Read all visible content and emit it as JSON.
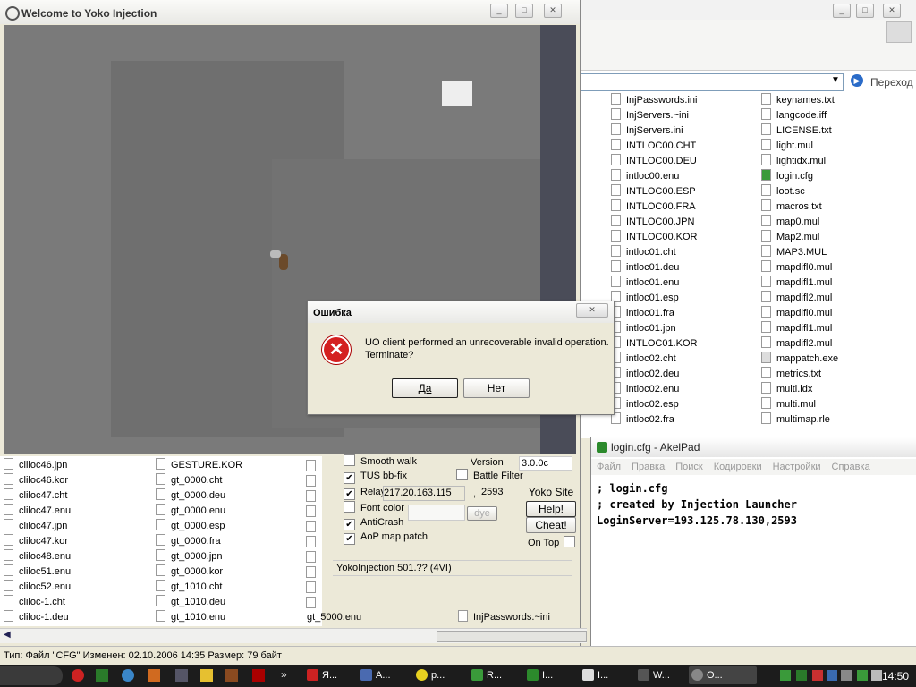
{
  "yoko_window": {
    "title": "Welcome to Yoko Injection",
    "settings": {
      "smooth_walk": "Smooth walk",
      "tus_bbfix": "TUS bb-fix",
      "relay_label": "Relay",
      "relay_ip": "217.20.163.115",
      "relay_sep": ",",
      "relay_port": "2593",
      "font_color": "Font color",
      "dye": "dye",
      "anticrash": "AntiCrash",
      "aop_patch": "AoP map patch",
      "version_label": "Version",
      "version_value": "3.0.0c",
      "battle_filter": "Battle Filter",
      "yoko_site": "Yoko Site",
      "help": "Help!",
      "cheat": "Cheat!",
      "on_top": "On Top",
      "status": "YokoInjection 501.?? (4VI)"
    }
  },
  "error_dialog": {
    "title": "Ошибка",
    "message_line1": "UO client performed an unrecoverable invalid operation.",
    "message_line2": "Terminate?",
    "yes": "Да",
    "no": "Нет"
  },
  "explorer": {
    "go_label": "Переход",
    "col1": [
      "InjPasswords.ini",
      "InjServers.~ini",
      "InjServers.ini",
      "INTLOC00.CHT",
      "INTLOC00.DEU",
      "intloc00.enu",
      "INTLOC00.ESP",
      "INTLOC00.FRA",
      "INTLOC00.JPN",
      "INTLOC00.KOR",
      "intloc01.cht",
      "intloc01.deu",
      "intloc01.enu",
      "intloc01.esp",
      "intloc01.fra",
      "intloc01.jpn",
      "INTLOC01.KOR",
      "intloc02.cht",
      "intloc02.deu",
      "intloc02.enu",
      "intloc02.esp",
      "intloc02.fra"
    ],
    "col2": [
      "keynames.txt",
      "langcode.iff",
      "LICENSE.txt",
      "light.mul",
      "lightidx.mul",
      "login.cfg",
      "loot.sc",
      "macros.txt",
      "map0.mul",
      "Map2.mul",
      "MAP3.MUL",
      "mapdifl0.mul",
      "mapdifl1.mul",
      "mapdifl2.mul",
      "mapdifl0.mul",
      "mapdifl1.mul",
      "mapdifl2.mul",
      "mappatch.exe",
      "metrics.txt",
      "multi.idx",
      "multi.mul",
      "multimap.rle"
    ],
    "bottom_col1": [
      "cliloc46.jpn",
      "cliloc46.kor",
      "cliloc47.cht",
      "cliloc47.enu",
      "cliloc47.jpn",
      "cliloc47.kor",
      "cliloc48.enu",
      "cliloc51.enu",
      "cliloc52.enu",
      "cliloc-1.cht",
      "cliloc-1.deu"
    ],
    "bottom_col2": [
      "GESTURE.KOR",
      "gt_0000.cht",
      "gt_0000.deu",
      "gt_0000.enu",
      "gt_0000.esp",
      "gt_0000.fra",
      "gt_0000.jpn",
      "gt_0000.kor",
      "gt_1010.cht",
      "gt_1010.deu",
      "gt_1010.enu"
    ],
    "extra_col3": "gt_5000.enu",
    "extra_col4": "InjPasswords.~ini",
    "status_bar": "Тип: Файл \"CFG\" Изменен: 02.10.2006 14:35 Размер: 79 байт"
  },
  "akelpad": {
    "title": "login.cfg - AkelPad",
    "menu": [
      "Файл",
      "Правка",
      "Поиск",
      "Кодировки",
      "Настройки",
      "Справка"
    ],
    "lines": [
      "; login.cfg",
      "; created by Injection Launcher",
      "LoginServer=193.125.78.130,2593"
    ]
  },
  "taskbar": {
    "clock": "14:50",
    "tasks": [
      "Я...",
      "A...",
      "p...",
      "R...",
      "I...",
      "I...",
      "W...",
      "O..."
    ]
  },
  "colors": {
    "game_bg": "#787878",
    "taskbar": "#1c1c1c",
    "error_red": "#d42020"
  }
}
